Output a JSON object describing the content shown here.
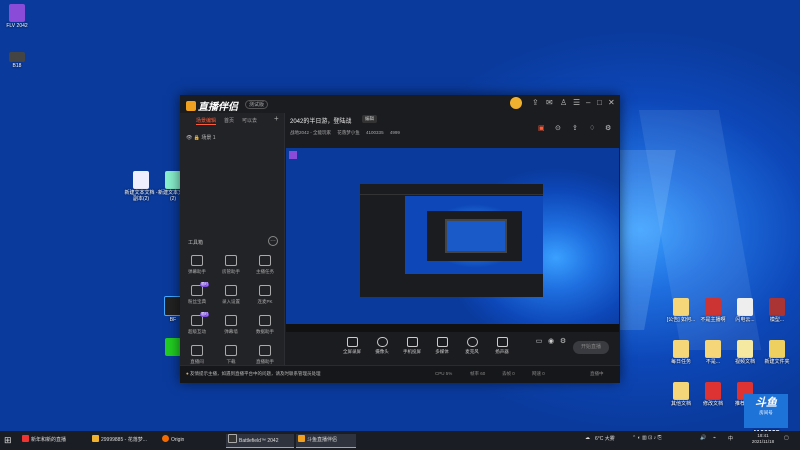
{
  "desktop": {
    "icons_left": [
      {
        "label": "FLV\n2042"
      },
      {
        "label": "B18"
      },
      {
        "label": "新建文本文档 - 副本(2)"
      },
      {
        "label": "新建文本文档(2)"
      },
      {
        "label": "BF"
      },
      {
        "label": ""
      }
    ],
    "icons_right": [
      {
        "label": "[公告] 如何..."
      },
      {
        "label": "不是主播啊"
      },
      {
        "label": "闪电云..."
      },
      {
        "label": "模型..."
      },
      {
        "label": "每日任务"
      },
      {
        "label": "不是..."
      },
      {
        "label": "视频文档"
      },
      {
        "label": "新建文件夹"
      },
      {
        "label": "其他文档"
      },
      {
        "label": "修改文档"
      },
      {
        "label": "推荐文档"
      }
    ],
    "room_card": {
      "logo": "斗鱼",
      "subtitle": "房间号",
      "number": "4100335"
    }
  },
  "app": {
    "logo": "直播伴侣",
    "version_badge": "测试版",
    "title_controls": [
      "avatar",
      "share-icon",
      "message-icon",
      "skin-icon",
      "settings-icon",
      "minimize-icon",
      "maximize-icon",
      "close-icon"
    ],
    "sidebar": {
      "tabs": [
        "场景编辑",
        "首页",
        "可以去"
      ],
      "add_label": "+",
      "scene_label": "场景 1",
      "tools_title": "工具箱",
      "tools": [
        {
          "label": "弹幕助手"
        },
        {
          "label": "房管助手"
        },
        {
          "label": "主播任务"
        },
        {
          "label": "粉丝宝典",
          "badge": "限时"
        },
        {
          "label": "录入设置"
        },
        {
          "label": "连麦PK"
        },
        {
          "label": "超级互动",
          "badge": "限时"
        },
        {
          "label": "弹幕墙"
        },
        {
          "label": "数据助手"
        },
        {
          "label": "直播间"
        },
        {
          "label": "下载"
        },
        {
          "label": "直播助手"
        }
      ]
    },
    "room": {
      "title": "2042的半日游，登陆战",
      "edit_label": "编辑",
      "category": "战地2042 - 全能玩家",
      "host": "花落梦小鱼",
      "room_id": "4100335",
      "fans": "4999"
    },
    "bottom_buttons": [
      "全屏录屏",
      "摄像头",
      "手机投屏",
      "多媒体",
      "麦克风",
      "扬声器"
    ],
    "start_live_label": "开始直播",
    "notice": "友情提示主播，如遇到直播平台中的问题，请及时联系管理员处理",
    "stats": [
      "CPU 5%",
      "帧率 60",
      "丢帧 0",
      "网速 0",
      "直播中"
    ]
  },
  "taskbar": {
    "items": [
      {
        "label": "新年和新的直播"
      },
      {
        "label": "29999885 - 花落梦..."
      },
      {
        "label": "Origin"
      },
      {
        "label": "Battlefield™ 2042"
      },
      {
        "label": "斗鱼直播伴侣"
      }
    ],
    "weather": "6°C 大雾",
    "lang": "中",
    "time": "18:41",
    "date": "2021/11/18"
  }
}
